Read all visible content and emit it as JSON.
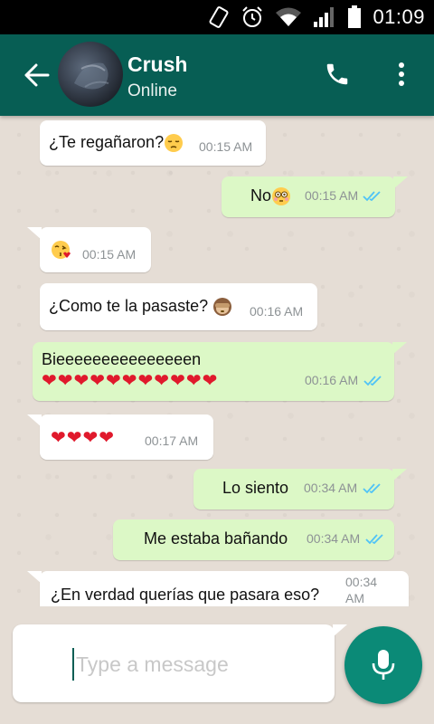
{
  "status_bar": {
    "time": "01:09"
  },
  "header": {
    "contact_name": "Crush",
    "contact_status": "Online"
  },
  "messages": [
    {
      "direction": "in",
      "text": "¿Te regañaron?",
      "emoji": "pensive-face",
      "time": "00:15 AM"
    },
    {
      "direction": "out",
      "text": "No",
      "emoji": "flushed-face",
      "time": "00:15 AM",
      "read": true
    },
    {
      "direction": "in",
      "text": "",
      "emoji": "face-blowing-kiss",
      "time": "00:15 AM"
    },
    {
      "direction": "in",
      "text": "¿Como te la pasaste?",
      "emoji": "see-no-evil-monkey",
      "time": "00:16 AM"
    },
    {
      "direction": "out",
      "text": "Bieeeeeeeeeeeeeeen",
      "hearts": "❤❤❤❤❤❤❤❤❤❤❤",
      "time": "00:16 AM",
      "read": true
    },
    {
      "direction": "in",
      "text": "",
      "hearts": "❤❤❤❤",
      "time": "00:17 AM"
    },
    {
      "direction": "out",
      "text": "Lo siento",
      "time": "00:34 AM",
      "read": true
    },
    {
      "direction": "out",
      "text": "Me estaba bañando",
      "time": "00:34 AM",
      "read": true
    },
    {
      "direction": "in",
      "text": "¿En verdad querías que pasara eso?",
      "time_line1": "00:34",
      "time_line2": "AM"
    }
  ],
  "composer": {
    "placeholder": "Type a message"
  },
  "colors": {
    "header": "#075e54",
    "chat_background": "#e5ddd5",
    "outgoing_bubble": "#dcf8c6",
    "incoming_bubble": "#ffffff",
    "read_ticks": "#4fc3f7",
    "mic_button": "#0b8a77"
  }
}
